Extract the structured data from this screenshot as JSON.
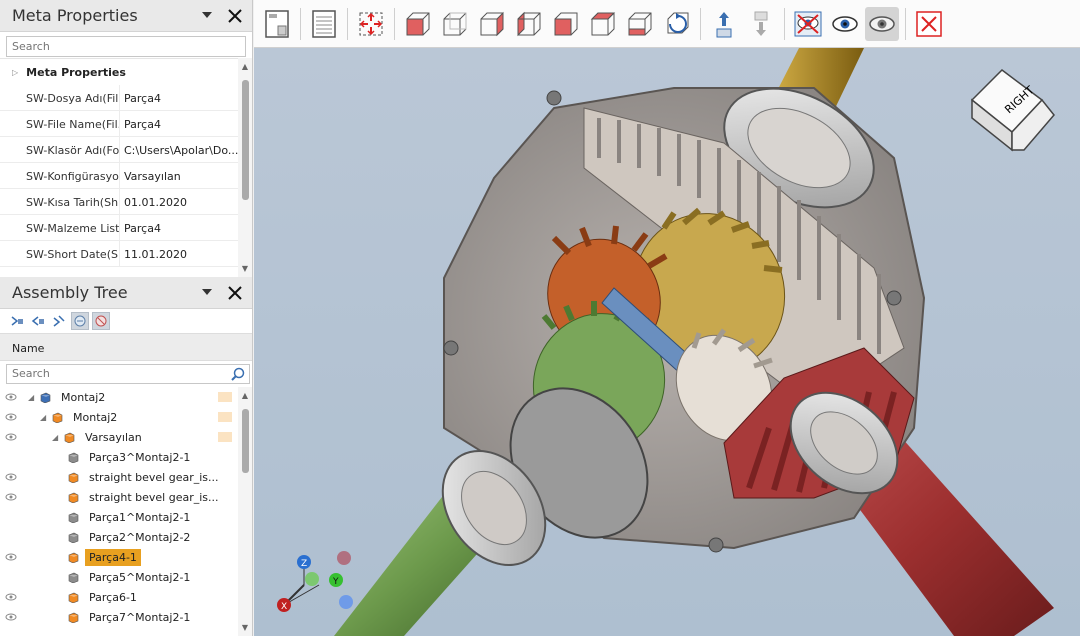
{
  "meta_panel": {
    "title": "Meta Properties",
    "search_placeholder": "Search",
    "group_label": "Meta Properties",
    "rows": [
      {
        "key": "SW-Dosya Adı(Fil...",
        "value": "Parça4"
      },
      {
        "key": "SW-File Name(Fil...",
        "value": "Parça4"
      },
      {
        "key": "SW-Klasör Adı(Fo...",
        "value": "C:\\Users\\Apolar\\Do..."
      },
      {
        "key": "SW-Konfigürasyo...",
        "value": "Varsayılan"
      },
      {
        "key": "SW-Kısa Tarih(Sh...",
        "value": "01.01.2020"
      },
      {
        "key": "SW-Malzeme List...",
        "value": "Parça4"
      },
      {
        "key": "SW-Short Date(S...",
        "value": "11.01.2020"
      }
    ]
  },
  "tree_panel": {
    "title": "Assembly Tree",
    "column_header": "Name",
    "search_placeholder": "Search",
    "nodes": [
      {
        "label": "Montaj2",
        "level": 0,
        "eye": true,
        "expander": "◢",
        "kind": "assembly",
        "tag": true
      },
      {
        "label": "Montaj2",
        "level": 1,
        "eye": true,
        "expander": "◢",
        "kind": "assembly-orange",
        "tag": true
      },
      {
        "label": "Varsayılan",
        "level": 2,
        "eye": true,
        "expander": "◢",
        "kind": "config",
        "tag": true
      },
      {
        "label": "Parça3^Montaj2-1",
        "level": 3,
        "eye": false,
        "kind": "gray"
      },
      {
        "label": "straight bevel gear_is...",
        "level": 3,
        "eye": true,
        "kind": "orange"
      },
      {
        "label": "straight bevel gear_is...",
        "level": 3,
        "eye": true,
        "kind": "orange"
      },
      {
        "label": "Parça1^Montaj2-1",
        "level": 3,
        "eye": false,
        "kind": "gray"
      },
      {
        "label": "Parça2^Montaj2-2",
        "level": 3,
        "eye": false,
        "kind": "gray"
      },
      {
        "label": "Parça4-1",
        "level": 3,
        "eye": true,
        "kind": "orange",
        "selected": true
      },
      {
        "label": "Parça5^Montaj2-1",
        "level": 3,
        "eye": false,
        "kind": "gray"
      },
      {
        "label": "Parça6-1",
        "level": 3,
        "eye": true,
        "kind": "orange"
      },
      {
        "label": "Parça7^Montaj2-1",
        "level": 3,
        "eye": true,
        "kind": "orange"
      }
    ]
  },
  "view_cube": {
    "face_label": "RIGHT"
  },
  "triad": {
    "x_label": "X",
    "y_label": "Y",
    "z_label": "Z"
  },
  "colors": {
    "selection": "#e8a020",
    "viewport_bg": "#b6c4d4",
    "accent_red": "#d9534f"
  }
}
